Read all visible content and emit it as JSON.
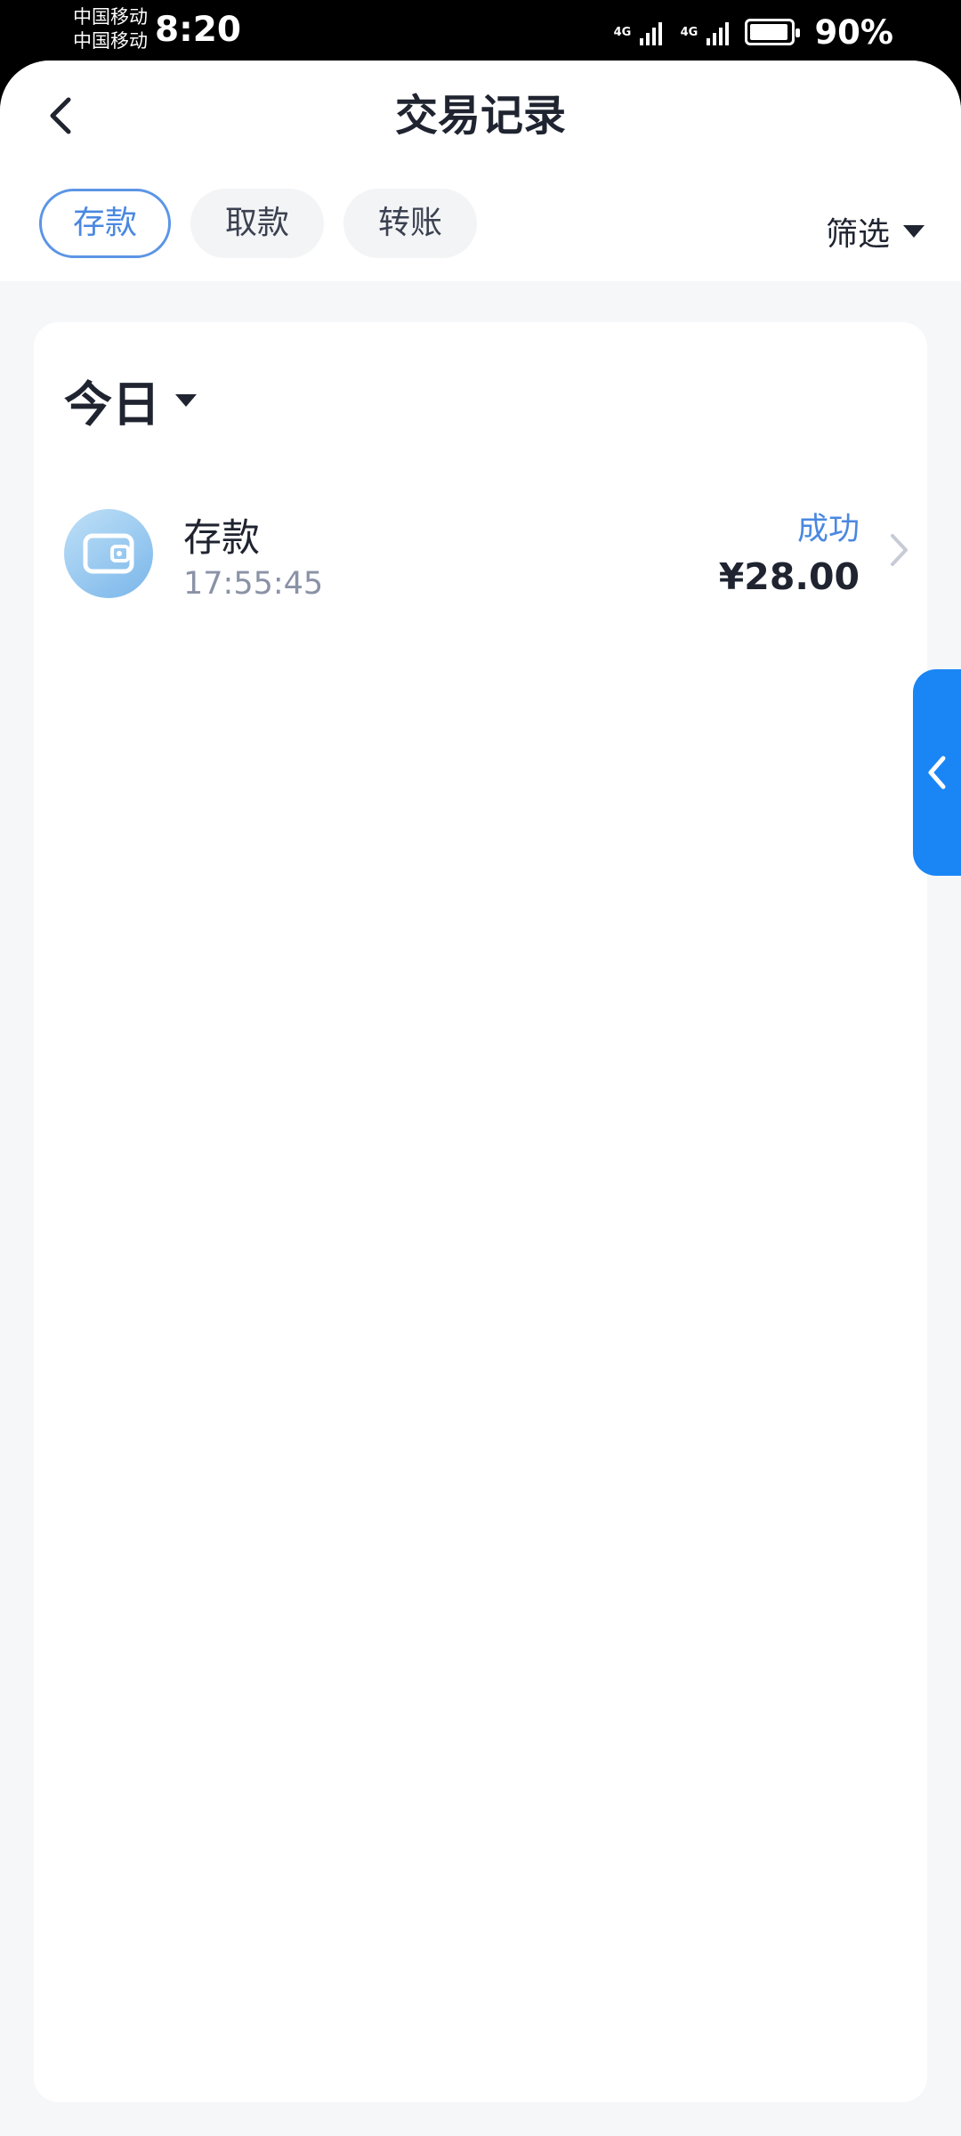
{
  "status_bar": {
    "carrier_1": "中国移动",
    "carrier_2": "中国移动",
    "time": "8:20",
    "network_1": "4G",
    "network_2": "4G",
    "battery": "90%"
  },
  "header": {
    "title": "交易记录",
    "back_icon": "chevron-left-icon"
  },
  "tabs": [
    {
      "label": "存款",
      "active": true
    },
    {
      "label": "取款",
      "active": false
    },
    {
      "label": "转账",
      "active": false
    }
  ],
  "filter": {
    "label": "筛选",
    "icon": "caret-down-icon"
  },
  "records": {
    "day_label": "今日",
    "items": [
      {
        "title": "存款",
        "time": "17:55:45",
        "status": "成功",
        "amount": "¥28.00",
        "icon": "wallet-icon"
      }
    ]
  },
  "colors": {
    "accent": "#4a88e0",
    "side_handle": "#1a86f5",
    "text_primary": "#1f2430",
    "text_secondary": "#8a92a6"
  }
}
